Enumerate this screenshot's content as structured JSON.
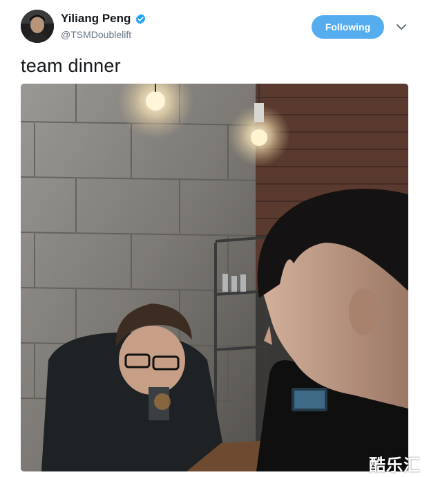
{
  "author": {
    "name": "Yiliang Peng",
    "handle": "@TSMDoublelift",
    "verified": true
  },
  "follow_button": {
    "label": "Following"
  },
  "tweet": {
    "text": "team dinner"
  },
  "media": {
    "type": "photo",
    "watermark": "酷乐汇"
  },
  "colors": {
    "accent": "#55acee",
    "verified_badge": "#1da1f2",
    "text_primary": "#14171a",
    "text_secondary": "#657786"
  },
  "icons": [
    "verified-badge-icon",
    "chevron-down-icon"
  ]
}
